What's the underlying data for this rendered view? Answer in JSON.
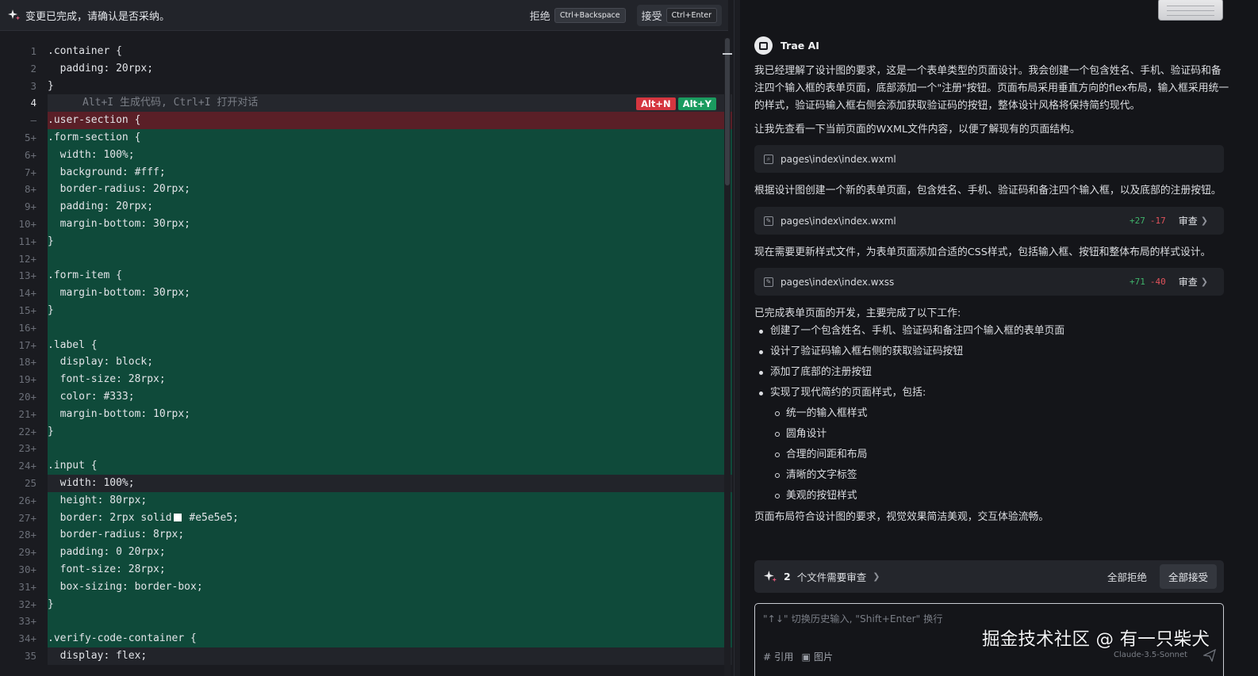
{
  "diff_bar": {
    "message": "变更已完成，请确认是否采纳。",
    "reject_label": "拒绝",
    "reject_shortcut": "Ctrl+Backspace",
    "accept_label": "接受",
    "accept_shortcut": "Ctrl+Enter"
  },
  "editor": {
    "inline_hint": "Alt+I 生成代码, Ctrl+I 打开对话",
    "hint_reject_shortcut": "Alt+N",
    "hint_accept_shortcut": "Alt+Y",
    "lines": [
      {
        "no": "1",
        "text": ".container {",
        "kind": "normal"
      },
      {
        "no": "2",
        "text": "  padding: 20rpx;",
        "kind": "normal"
      },
      {
        "no": "3",
        "text": "}",
        "kind": "normal"
      },
      {
        "no": "4",
        "text": "",
        "kind": "hint",
        "active": true
      },
      {
        "no": "—",
        "text": ".user-section {",
        "kind": "removed"
      },
      {
        "no": "5+",
        "text": ".form-section {",
        "kind": "added"
      },
      {
        "no": "6+",
        "text": "  width: 100%;",
        "kind": "added"
      },
      {
        "no": "7+",
        "text": "  background: #fff;",
        "kind": "added"
      },
      {
        "no": "8+",
        "text": "  border-radius: 20rpx;",
        "kind": "added"
      },
      {
        "no": "9+",
        "text": "  padding: 20rpx;",
        "kind": "added"
      },
      {
        "no": "10+",
        "text": "  margin-bottom: 30rpx;",
        "kind": "added"
      },
      {
        "no": "11+",
        "text": "}",
        "kind": "added"
      },
      {
        "no": "12+",
        "text": "",
        "kind": "added"
      },
      {
        "no": "13+",
        "text": ".form-item {",
        "kind": "added"
      },
      {
        "no": "14+",
        "text": "  margin-bottom: 30rpx;",
        "kind": "added"
      },
      {
        "no": "15+",
        "text": "}",
        "kind": "added"
      },
      {
        "no": "16+",
        "text": "",
        "kind": "added"
      },
      {
        "no": "17+",
        "text": ".label {",
        "kind": "added"
      },
      {
        "no": "18+",
        "text": "  display: block;",
        "kind": "added"
      },
      {
        "no": "19+",
        "text": "  font-size: 28rpx;",
        "kind": "added"
      },
      {
        "no": "20+",
        "text": "  color: #333;",
        "kind": "added"
      },
      {
        "no": "21+",
        "text": "  margin-bottom: 10rpx;",
        "kind": "added"
      },
      {
        "no": "22+",
        "text": "}",
        "kind": "added"
      },
      {
        "no": "23+",
        "text": "",
        "kind": "added"
      },
      {
        "no": "24+",
        "text": ".input {",
        "kind": "added"
      },
      {
        "no": "25",
        "text": "  width: 100%;",
        "kind": "current"
      },
      {
        "no": "26+",
        "text": "  height: 80rpx;",
        "kind": "added"
      },
      {
        "no": "27+",
        "text": "  border: 2rpx solid",
        "suffix": " #e5e5e5;",
        "swatch": "#ffffff",
        "kind": "added"
      },
      {
        "no": "28+",
        "text": "  border-radius: 8rpx;",
        "kind": "added"
      },
      {
        "no": "29+",
        "text": "  padding: 0 20rpx;",
        "kind": "added"
      },
      {
        "no": "30+",
        "text": "  font-size: 28rpx;",
        "kind": "added"
      },
      {
        "no": "31+",
        "text": "  box-sizing: border-box;",
        "kind": "added"
      },
      {
        "no": "32+",
        "text": "}",
        "kind": "added"
      },
      {
        "no": "33+",
        "text": "",
        "kind": "added"
      },
      {
        "no": "34+",
        "text": ".verify-code-container {",
        "kind": "added"
      },
      {
        "no": "35",
        "text": "  display: flex;",
        "kind": "current"
      }
    ]
  },
  "chat": {
    "ai_name": "Trae AI",
    "para1": "我已经理解了设计图的要求，这是一个表单类型的页面设计。我会创建一个包含姓名、手机、验证码和备注四个输入框的表单页面，底部添加一个\"注册\"按钮。页面布局采用垂直方向的flex布局，输入框采用统一的样式，验证码输入框右侧会添加获取验证码的按钮，整体设计风格将保持简约现代。",
    "para2": "让我先查看一下当前页面的WXML文件内容，以便了解现有的页面结构。",
    "search_card": {
      "path": "pages\\index\\index.wxml"
    },
    "para3": "根据设计图创建一个新的表单页面，包含姓名、手机、验证码和备注四个输入框，以及底部的注册按钮。",
    "edit_card_1": {
      "path": "pages\\index\\index.wxml",
      "added": "+27",
      "removed": "-17",
      "review": "审查"
    },
    "para4": "现在需要更新样式文件，为表单页面添加合适的CSS样式，包括输入框、按钮和整体布局的样式设计。",
    "edit_card_2": {
      "path": "pages\\index\\index.wxss",
      "added": "+71",
      "removed": "-40",
      "review": "审查"
    },
    "summary_intro": "已完成表单页面的开发，主要完成了以下工作:",
    "bullets": [
      {
        "text": "创建了一个包含姓名、手机、验证码和备注四个输入框的表单页面",
        "level": 1
      },
      {
        "text": "设计了验证码输入框右侧的获取验证码按钮",
        "level": 1
      },
      {
        "text": "添加了底部的注册按钮",
        "level": 1
      },
      {
        "text": "实现了现代简约的页面样式，包括:",
        "level": 1
      },
      {
        "text": "统一的输入框样式",
        "level": 2
      },
      {
        "text": "圆角设计",
        "level": 2
      },
      {
        "text": "合理的间距和布局",
        "level": 2
      },
      {
        "text": "清晰的文字标签",
        "level": 2
      },
      {
        "text": "美观的按钮样式",
        "level": 2
      }
    ],
    "conclusion": "页面布局符合设计图的要求，视觉效果简洁美观，交互体验流畅。",
    "review_bar": {
      "count": "2",
      "label": "个文件需要审查",
      "reject_all": "全部拒绝",
      "accept_all": "全部接受"
    },
    "input": {
      "placeholder": "\"↑↓\" 切换历史输入, \"Shift+Enter\" 换行",
      "ref_label": "# 引用",
      "image_label": "图片",
      "model": "Claude-3.5-Sonnet"
    },
    "watermark": "掘金技术社区 @ 有一只柴犬"
  },
  "colors": {
    "added_bg": "#0f4a3a",
    "removed_bg": "#5a1f27",
    "reject_badge": "#d5363f",
    "accept_badge": "#1a9b5f",
    "plus_green": "#3fb36b",
    "minus_red": "#e0525b"
  }
}
